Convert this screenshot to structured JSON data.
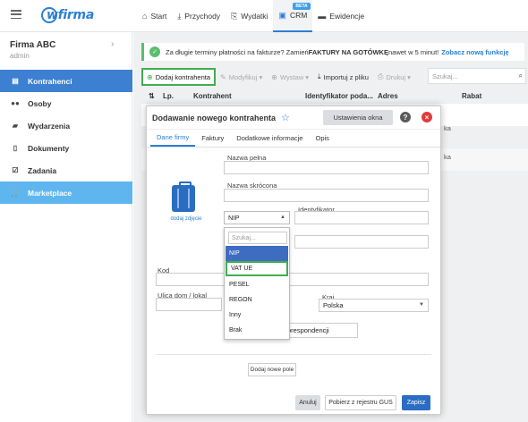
{
  "topbar": {
    "logo": "wfirma",
    "nav": [
      {
        "label": "Start",
        "icon": "home-icon"
      },
      {
        "label": "Przychody",
        "icon": "income-icon"
      },
      {
        "label": "Wydatki",
        "icon": "expenses-icon"
      },
      {
        "label": "CRM",
        "icon": "crm-icon",
        "badge": "BETA",
        "active": true
      },
      {
        "label": "Ewidencje",
        "icon": "folder-icon"
      }
    ]
  },
  "sidebar": {
    "company_name": "Firma ABC",
    "company_role": "admin",
    "items": [
      {
        "label": "Kontrahenci",
        "icon": "contacts-icon"
      },
      {
        "label": "Osoby",
        "icon": "people-icon"
      },
      {
        "label": "Wydarzenia",
        "icon": "events-icon"
      },
      {
        "label": "Dokumenty",
        "icon": "documents-icon"
      },
      {
        "label": "Zadania",
        "icon": "tasks-icon"
      },
      {
        "label": "Marketplace",
        "icon": "cart-icon"
      }
    ]
  },
  "banner": {
    "text_before": "Za długie terminy płatności na fakturze? Zamień ",
    "bold": "FAKTURY NA GOTÓWKĘ",
    "text_after": " nawet w 5 minut!",
    "link": "Zobacz nową funkcję"
  },
  "toolbar": {
    "add": "Dodaj kontrahenta",
    "modify": "Modyfikuj",
    "send": "Wystaw",
    "import": "Importuj z pliku",
    "print": "Drukuj",
    "search_placeholder": "Szukaj..."
  },
  "table": {
    "columns": [
      "Lp.",
      "Kontrahent",
      "Identyfikator poda...",
      "Adres",
      "Rabat"
    ],
    "row_fragments": [
      "ka",
      "ka"
    ]
  },
  "modal": {
    "title": "Dodawanie nowego kontrahenta",
    "settings_button": "Ustawienia okna",
    "tabs": [
      "Dane firmy",
      "Faktury",
      "Dodatkowe informacje",
      "Opis"
    ],
    "fields": {
      "full_name_label": "Nazwa pełna",
      "short_name_label": "Nazwa skrócona",
      "identifier_label": "Identyfikator",
      "id_type_value": "NIP",
      "postal_code_label": "Kod",
      "street_label": "Ulica dom / lokal",
      "country_label": "Kraj",
      "country_value": "Polska",
      "correspondence_button": "orespondencji"
    },
    "photo_label": "dodaj zdjęcie",
    "dropdown": {
      "search_placeholder": "Szukaj...",
      "options": [
        "NIP",
        "VAT UE",
        "PESEL",
        "REGON",
        "Inny",
        "Brak"
      ]
    },
    "add_field_button": "Dodaj nowe pole",
    "buttons": {
      "cancel": "Anuluj",
      "gus": "Pobierz z rejestru GUS",
      "save": "Zapisz"
    }
  }
}
